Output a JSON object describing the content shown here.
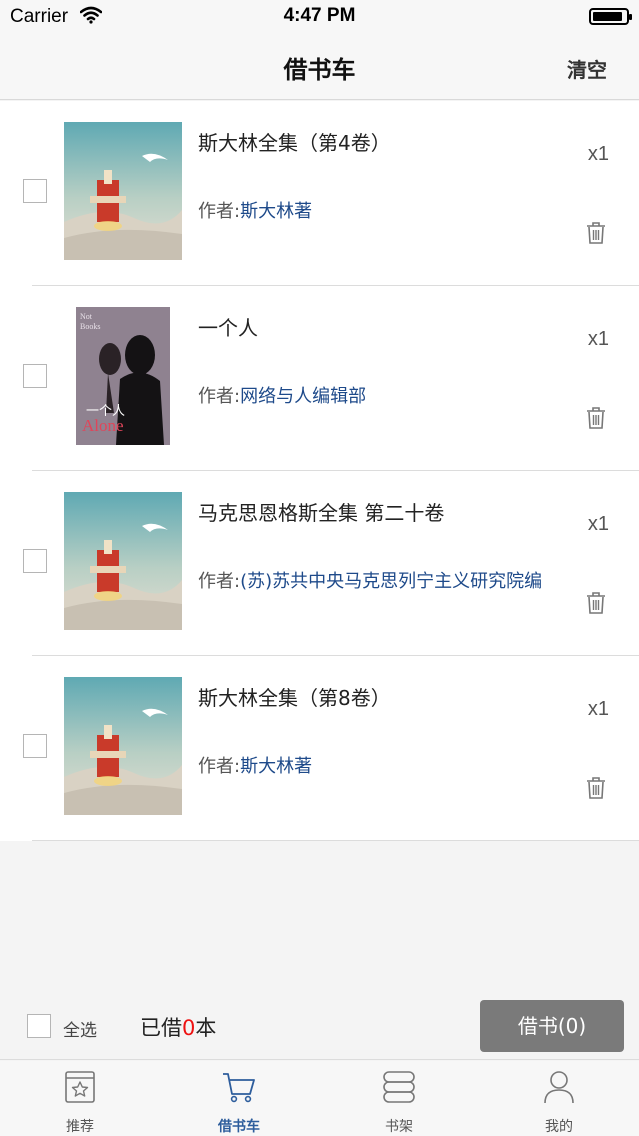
{
  "status_bar": {
    "carrier": "Carrier",
    "time": "4:47 PM",
    "battery_level": 0.92
  },
  "nav": {
    "title": "借书车",
    "clear_label": "清空"
  },
  "author_prefix": "作者:",
  "items": [
    {
      "title": "斯大林全集（第4卷）",
      "author": "斯大林著",
      "qty": "x1"
    },
    {
      "title": "一个人",
      "author": "网络与人编辑部",
      "qty": "x1"
    },
    {
      "title": "马克思恩格斯全集 第二十卷",
      "author": "(苏)苏共中央马克思列宁主义研究院编",
      "qty": "x1"
    },
    {
      "title": "斯大林全集（第8卷）",
      "author": "斯大林著",
      "qty": "x1"
    }
  ],
  "cover_text": {
    "line1": "Not",
    "line2": "Books",
    "cn": "一个人",
    "en": "Alone"
  },
  "action_bar": {
    "select_all_label": "全选",
    "borrowed_prefix": "已借",
    "borrowed_count": "0",
    "borrowed_suffix": "本",
    "borrow_button": "借书(0)"
  },
  "tabs": [
    {
      "label": "推荐",
      "icon": "star-book-icon",
      "active": false
    },
    {
      "label": "借书车",
      "icon": "cart-icon",
      "active": true
    },
    {
      "label": "书架",
      "icon": "bookshelf-icon",
      "active": false
    },
    {
      "label": "我的",
      "icon": "person-icon",
      "active": false
    }
  ],
  "colors": {
    "accent": "#2d5d9c",
    "author_link": "#1e4a8a",
    "count_red": "#ee1111",
    "button_gray": "#7a7a7a"
  }
}
